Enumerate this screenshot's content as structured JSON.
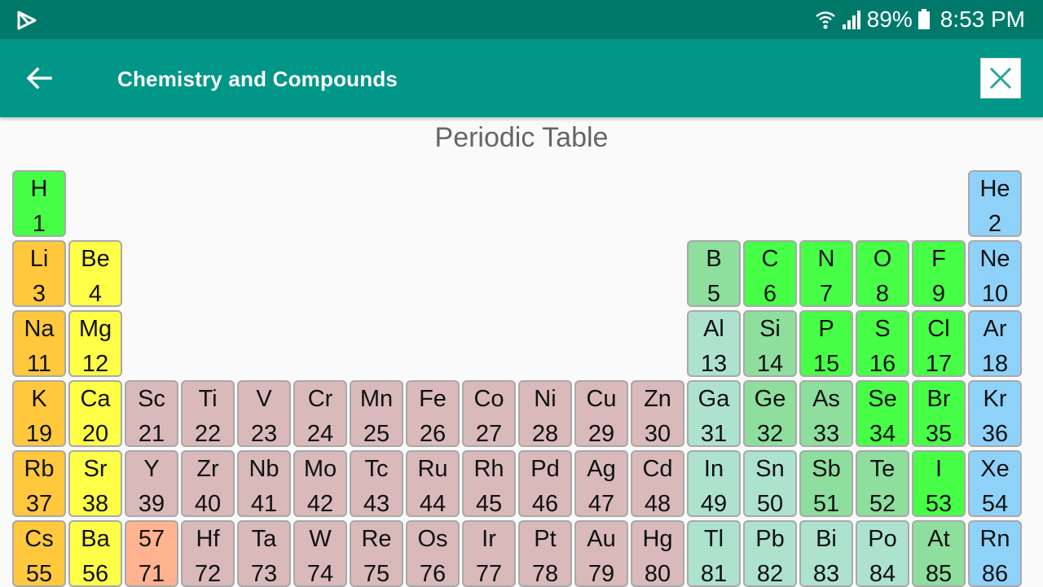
{
  "status_bar": {
    "battery": "89%",
    "time": "8:53 PM",
    "icons": [
      "play-store-icon",
      "wifi-icon",
      "signal-icon",
      "battery-icon"
    ]
  },
  "app_bar": {
    "title": "Chemistry and Compounds",
    "back_icon": "arrow-left-icon",
    "close_icon": "close-icon"
  },
  "page_title": "Periodic Table",
  "colors": {
    "status_bar": "#00796b",
    "app_bar": "#009688",
    "alkali": "#ffc83d",
    "alkaline_earth": "#ffff47",
    "transition": "#d9b9b9",
    "lanthanide": "#ffb38f",
    "post_transition": "#ade2cf",
    "metalloid": "#8ede9e",
    "nonmetal": "#47ff47",
    "noble_gas": "#8ed2fa"
  },
  "elements": [
    {
      "symbol": "H",
      "number": "1",
      "row": 1,
      "col": 1,
      "category": "nonmetal"
    },
    {
      "symbol": "He",
      "number": "2",
      "row": 1,
      "col": 18,
      "category": "noble_gas"
    },
    {
      "symbol": "Li",
      "number": "3",
      "row": 2,
      "col": 1,
      "category": "alkali"
    },
    {
      "symbol": "Be",
      "number": "4",
      "row": 2,
      "col": 2,
      "category": "alkaline_earth"
    },
    {
      "symbol": "B",
      "number": "5",
      "row": 2,
      "col": 13,
      "category": "metalloid"
    },
    {
      "symbol": "C",
      "number": "6",
      "row": 2,
      "col": 14,
      "category": "nonmetal"
    },
    {
      "symbol": "N",
      "number": "7",
      "row": 2,
      "col": 15,
      "category": "nonmetal"
    },
    {
      "symbol": "O",
      "number": "8",
      "row": 2,
      "col": 16,
      "category": "nonmetal"
    },
    {
      "symbol": "F",
      "number": "9",
      "row": 2,
      "col": 17,
      "category": "nonmetal"
    },
    {
      "symbol": "Ne",
      "number": "10",
      "row": 2,
      "col": 18,
      "category": "noble_gas"
    },
    {
      "symbol": "Na",
      "number": "11",
      "row": 3,
      "col": 1,
      "category": "alkali"
    },
    {
      "symbol": "Mg",
      "number": "12",
      "row": 3,
      "col": 2,
      "category": "alkaline_earth"
    },
    {
      "symbol": "Al",
      "number": "13",
      "row": 3,
      "col": 13,
      "category": "post_transition"
    },
    {
      "symbol": "Si",
      "number": "14",
      "row": 3,
      "col": 14,
      "category": "metalloid"
    },
    {
      "symbol": "P",
      "number": "15",
      "row": 3,
      "col": 15,
      "category": "nonmetal"
    },
    {
      "symbol": "S",
      "number": "16",
      "row": 3,
      "col": 16,
      "category": "nonmetal"
    },
    {
      "symbol": "Cl",
      "number": "17",
      "row": 3,
      "col": 17,
      "category": "nonmetal"
    },
    {
      "symbol": "Ar",
      "number": "18",
      "row": 3,
      "col": 18,
      "category": "noble_gas"
    },
    {
      "symbol": "K",
      "number": "19",
      "row": 4,
      "col": 1,
      "category": "alkali"
    },
    {
      "symbol": "Ca",
      "number": "20",
      "row": 4,
      "col": 2,
      "category": "alkaline_earth"
    },
    {
      "symbol": "Sc",
      "number": "21",
      "row": 4,
      "col": 3,
      "category": "transition"
    },
    {
      "symbol": "Ti",
      "number": "22",
      "row": 4,
      "col": 4,
      "category": "transition"
    },
    {
      "symbol": "V",
      "number": "23",
      "row": 4,
      "col": 5,
      "category": "transition"
    },
    {
      "symbol": "Cr",
      "number": "24",
      "row": 4,
      "col": 6,
      "category": "transition"
    },
    {
      "symbol": "Mn",
      "number": "25",
      "row": 4,
      "col": 7,
      "category": "transition"
    },
    {
      "symbol": "Fe",
      "number": "26",
      "row": 4,
      "col": 8,
      "category": "transition"
    },
    {
      "symbol": "Co",
      "number": "27",
      "row": 4,
      "col": 9,
      "category": "transition"
    },
    {
      "symbol": "Ni",
      "number": "28",
      "row": 4,
      "col": 10,
      "category": "transition"
    },
    {
      "symbol": "Cu",
      "number": "29",
      "row": 4,
      "col": 11,
      "category": "transition"
    },
    {
      "symbol": "Zn",
      "number": "30",
      "row": 4,
      "col": 12,
      "category": "transition"
    },
    {
      "symbol": "Ga",
      "number": "31",
      "row": 4,
      "col": 13,
      "category": "post_transition"
    },
    {
      "symbol": "Ge",
      "number": "32",
      "row": 4,
      "col": 14,
      "category": "metalloid"
    },
    {
      "symbol": "As",
      "number": "33",
      "row": 4,
      "col": 15,
      "category": "metalloid"
    },
    {
      "symbol": "Se",
      "number": "34",
      "row": 4,
      "col": 16,
      "category": "nonmetal"
    },
    {
      "symbol": "Br",
      "number": "35",
      "row": 4,
      "col": 17,
      "category": "nonmetal"
    },
    {
      "symbol": "Kr",
      "number": "36",
      "row": 4,
      "col": 18,
      "category": "noble_gas"
    },
    {
      "symbol": "Rb",
      "number": "37",
      "row": 5,
      "col": 1,
      "category": "alkali"
    },
    {
      "symbol": "Sr",
      "number": "38",
      "row": 5,
      "col": 2,
      "category": "alkaline_earth"
    },
    {
      "symbol": "Y",
      "number": "39",
      "row": 5,
      "col": 3,
      "category": "transition"
    },
    {
      "symbol": "Zr",
      "number": "40",
      "row": 5,
      "col": 4,
      "category": "transition"
    },
    {
      "symbol": "Nb",
      "number": "41",
      "row": 5,
      "col": 5,
      "category": "transition"
    },
    {
      "symbol": "Mo",
      "number": "42",
      "row": 5,
      "col": 6,
      "category": "transition"
    },
    {
      "symbol": "Tc",
      "number": "43",
      "row": 5,
      "col": 7,
      "category": "transition"
    },
    {
      "symbol": "Ru",
      "number": "44",
      "row": 5,
      "col": 8,
      "category": "transition"
    },
    {
      "symbol": "Rh",
      "number": "45",
      "row": 5,
      "col": 9,
      "category": "transition"
    },
    {
      "symbol": "Pd",
      "number": "46",
      "row": 5,
      "col": 10,
      "category": "transition"
    },
    {
      "symbol": "Ag",
      "number": "47",
      "row": 5,
      "col": 11,
      "category": "transition"
    },
    {
      "symbol": "Cd",
      "number": "48",
      "row": 5,
      "col": 12,
      "category": "transition"
    },
    {
      "symbol": "In",
      "number": "49",
      "row": 5,
      "col": 13,
      "category": "post_transition"
    },
    {
      "symbol": "Sn",
      "number": "50",
      "row": 5,
      "col": 14,
      "category": "post_transition"
    },
    {
      "symbol": "Sb",
      "number": "51",
      "row": 5,
      "col": 15,
      "category": "metalloid"
    },
    {
      "symbol": "Te",
      "number": "52",
      "row": 5,
      "col": 16,
      "category": "metalloid"
    },
    {
      "symbol": "I",
      "number": "53",
      "row": 5,
      "col": 17,
      "category": "nonmetal"
    },
    {
      "symbol": "Xe",
      "number": "54",
      "row": 5,
      "col": 18,
      "category": "noble_gas"
    },
    {
      "symbol": "Cs",
      "number": "55",
      "row": 6,
      "col": 1,
      "category": "alkali"
    },
    {
      "symbol": "Ba",
      "number": "56",
      "row": 6,
      "col": 2,
      "category": "alkaline_earth"
    },
    {
      "symbol": "57",
      "number": "71",
      "row": 6,
      "col": 3,
      "category": "lanthanide"
    },
    {
      "symbol": "Hf",
      "number": "72",
      "row": 6,
      "col": 4,
      "category": "transition"
    },
    {
      "symbol": "Ta",
      "number": "73",
      "row": 6,
      "col": 5,
      "category": "transition"
    },
    {
      "symbol": "W",
      "number": "74",
      "row": 6,
      "col": 6,
      "category": "transition"
    },
    {
      "symbol": "Re",
      "number": "75",
      "row": 6,
      "col": 7,
      "category": "transition"
    },
    {
      "symbol": "Os",
      "number": "76",
      "row": 6,
      "col": 8,
      "category": "transition"
    },
    {
      "symbol": "Ir",
      "number": "77",
      "row": 6,
      "col": 9,
      "category": "transition"
    },
    {
      "symbol": "Pt",
      "number": "78",
      "row": 6,
      "col": 10,
      "category": "transition"
    },
    {
      "symbol": "Au",
      "number": "79",
      "row": 6,
      "col": 11,
      "category": "transition"
    },
    {
      "symbol": "Hg",
      "number": "80",
      "row": 6,
      "col": 12,
      "category": "transition"
    },
    {
      "symbol": "Tl",
      "number": "81",
      "row": 6,
      "col": 13,
      "category": "post_transition"
    },
    {
      "symbol": "Pb",
      "number": "82",
      "row": 6,
      "col": 14,
      "category": "post_transition"
    },
    {
      "symbol": "Bi",
      "number": "83",
      "row": 6,
      "col": 15,
      "category": "post_transition"
    },
    {
      "symbol": "Po",
      "number": "84",
      "row": 6,
      "col": 16,
      "category": "post_transition"
    },
    {
      "symbol": "At",
      "number": "85",
      "row": 6,
      "col": 17,
      "category": "metalloid"
    },
    {
      "symbol": "Rn",
      "number": "86",
      "row": 6,
      "col": 18,
      "category": "noble_gas"
    }
  ]
}
